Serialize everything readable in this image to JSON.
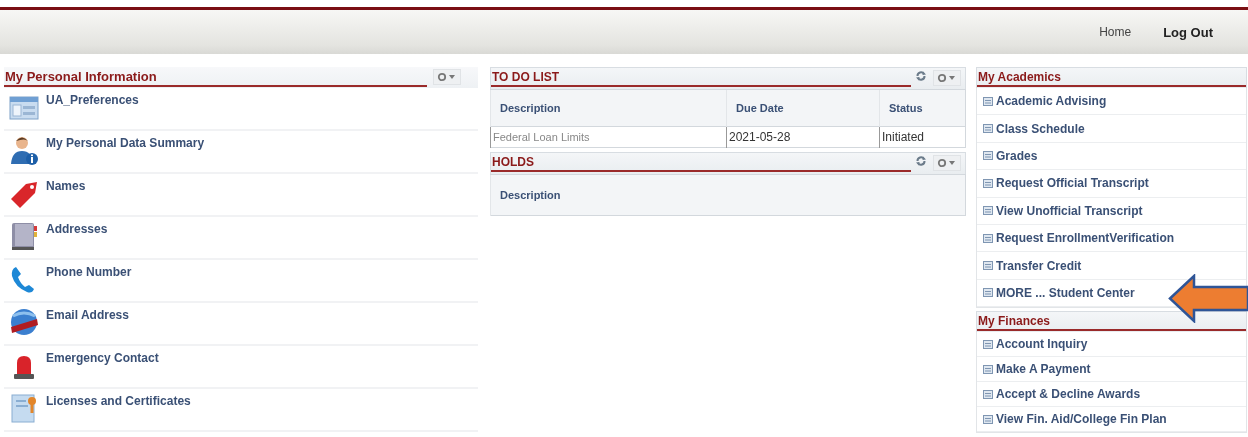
{
  "header": {
    "links": [
      {
        "label": "Home"
      },
      {
        "label": "Log Out"
      }
    ]
  },
  "personal_information": {
    "title": "My Personal Information",
    "items": [
      {
        "label": "UA_Preferences"
      },
      {
        "label": "My Personal Data Summary"
      },
      {
        "label": "Names"
      },
      {
        "label": "Addresses"
      },
      {
        "label": "Phone Number"
      },
      {
        "label": "Email Address"
      },
      {
        "label": "Emergency Contact"
      },
      {
        "label": "Licenses and Certificates"
      }
    ]
  },
  "todo_list": {
    "title": "TO DO LIST",
    "table": {
      "columns": [
        "Description",
        "Due Date",
        "Status"
      ],
      "rows": [
        [
          "Federal Loan Limits",
          "2021-05-28",
          "Initiated"
        ]
      ]
    }
  },
  "holds": {
    "title": "HOLDS",
    "table": {
      "columns": [
        "Description"
      ]
    }
  },
  "academics": {
    "title": "My Academics",
    "items": [
      {
        "label": "Academic Advising"
      },
      {
        "label": "Class Schedule"
      },
      {
        "label": "Grades"
      },
      {
        "label": "Request Official Transcript"
      },
      {
        "label": "View Unofficial Transcript"
      },
      {
        "label": "Request EnrollmentVerification"
      },
      {
        "label": "Transfer Credit"
      },
      {
        "label": "MORE ... Student Center"
      }
    ]
  },
  "finances": {
    "title": "My Finances",
    "items": [
      {
        "label": "Account Inquiry"
      },
      {
        "label": "Make A Payment"
      },
      {
        "label": "Accept & Decline Awards"
      },
      {
        "label": "View Fin. Aid/College Fin Plan"
      }
    ]
  }
}
